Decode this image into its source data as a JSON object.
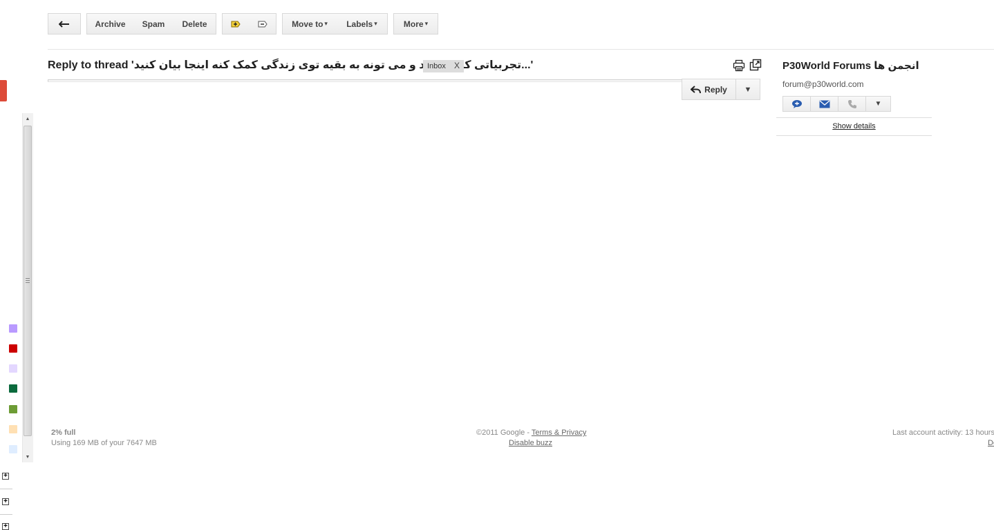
{
  "toolbar": {
    "archive": "Archive",
    "spam": "Spam",
    "delete": "Delete",
    "move_to": "Move to",
    "labels": "Labels",
    "more": "More",
    "caret": "▾"
  },
  "icons": {
    "back": "back-arrow-icon",
    "mark_important": "add-important-icon",
    "mark_not_important": "remove-important-icon",
    "print": "print-icon",
    "new_window": "new-window-icon",
    "reply": "reply-arrow-icon",
    "chat": "chat-icon",
    "email": "email-icon",
    "phone": "phone-icon"
  },
  "message": {
    "subject": "Reply to thread 'تجربیاتی که داشتید و می تونه به بقیه توی زندگی کمک کنه اینجا بیان کنید...'",
    "label": "Inbox",
    "label_remove": "X",
    "reply": "Reply",
    "reply_more": "▼"
  },
  "contact": {
    "name": "P30World Forums انجمن ها",
    "email": "forum@p30world.com",
    "more": "▼",
    "show_details": "Show details"
  },
  "sidebar": {
    "label_colors": [
      "#b99aff",
      "#cc0000",
      "#e3d7ff",
      "#0b6a3d",
      "#6d9c35",
      "#ffe0b3",
      "#dfedff"
    ],
    "plus": "+",
    "scroll_up": "▲",
    "scroll_down": "▼"
  },
  "footer": {
    "usage_percent": "2% full",
    "usage_detail": "Using 169 MB of your 7647 MB",
    "copyright": "©2011 Google -",
    "terms": "Terms & Privacy",
    "disable_buzz": "Disable buzz",
    "last_activity": "Last account activity: 13 hours",
    "details": "De"
  },
  "colors": {
    "accent_red": "#dd4b39",
    "icon_blue": "#2a5db0"
  }
}
